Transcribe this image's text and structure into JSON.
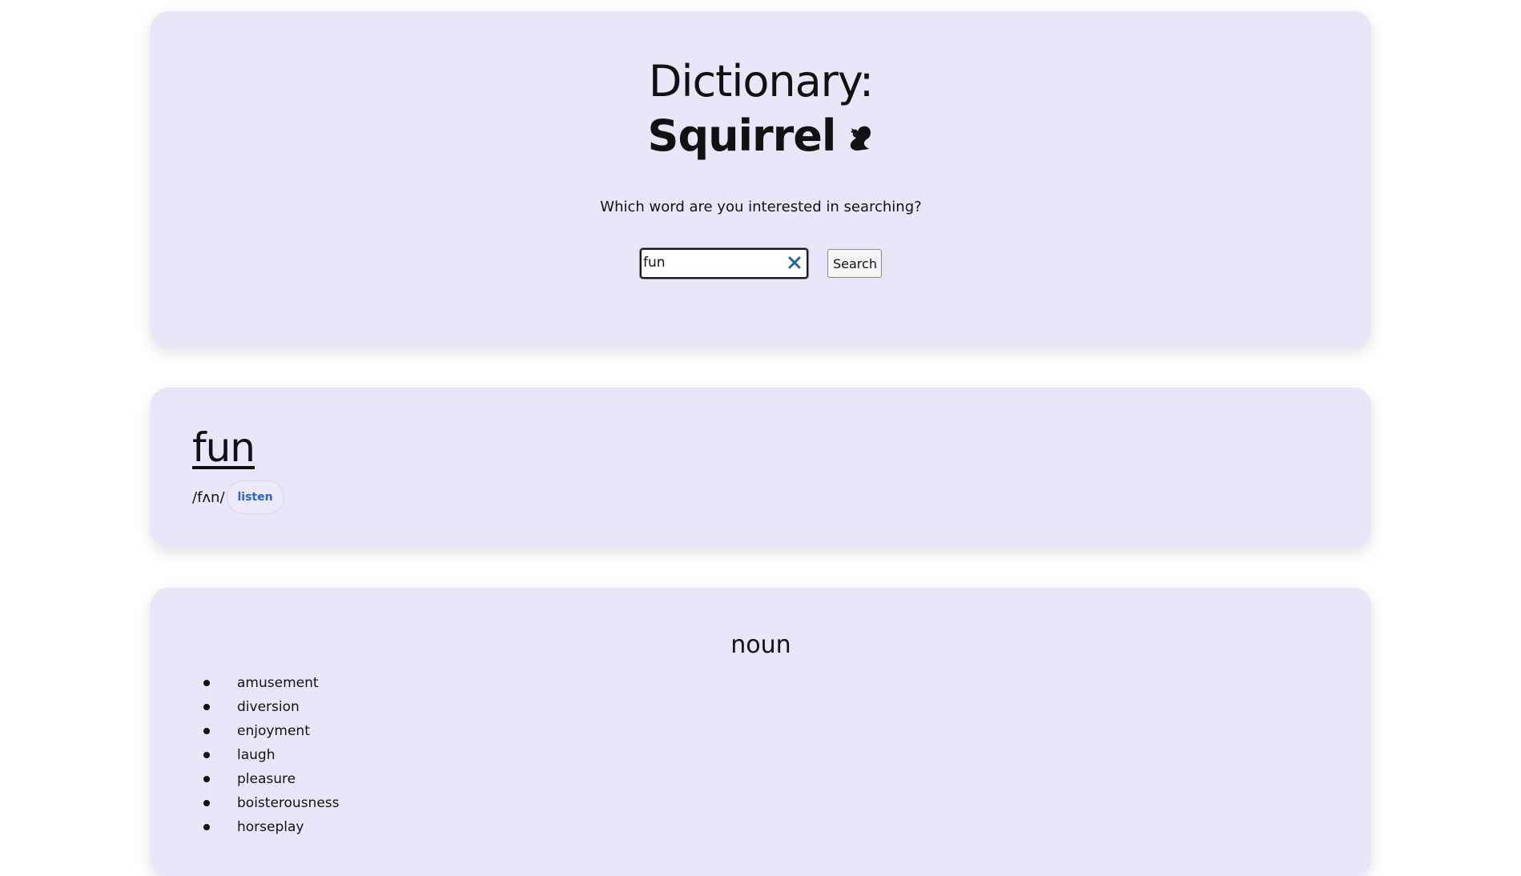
{
  "header": {
    "title": "Dictionary:",
    "app_name": "Squirrel",
    "app_icon": "squirrel-icon",
    "prompt": "Which word are you interested in searching?"
  },
  "search": {
    "value": "fun",
    "button_label": "Search",
    "clear_icon": "close-icon"
  },
  "result": {
    "word": "fun",
    "phonetic": "/fʌn/",
    "listen_label": "listen"
  },
  "meanings": [
    {
      "part_of_speech": "noun",
      "synonyms": [
        "amusement",
        "diversion",
        "enjoyment",
        "laugh",
        "pleasure",
        "boisterousness",
        "horseplay"
      ]
    }
  ],
  "colors": {
    "card_background": "#e8e6f8",
    "listen_text": "#2a63d6",
    "clear_icon": "#2b5fa8"
  }
}
